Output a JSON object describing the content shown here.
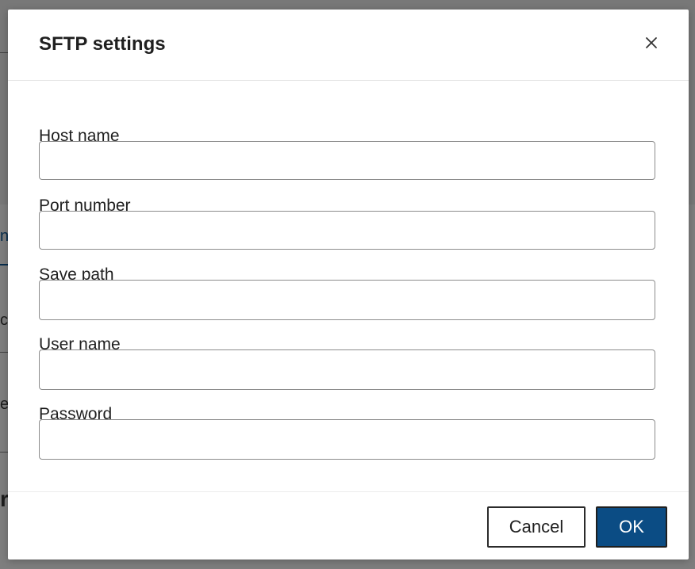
{
  "dialog": {
    "title": "SFTP settings",
    "close_icon": "close-icon",
    "fields": [
      {
        "label": "Host name",
        "value": "",
        "placeholder": ""
      },
      {
        "label": "Port number",
        "value": "",
        "placeholder": ""
      },
      {
        "label": "Save path",
        "value": "",
        "placeholder": ""
      },
      {
        "label": "User name",
        "value": "",
        "placeholder": ""
      },
      {
        "label": "Password",
        "value": "",
        "placeholder": ""
      }
    ],
    "buttons": {
      "cancel_label": "Cancel",
      "ok_label": "OK"
    }
  },
  "background": {
    "fragments": [
      "n",
      "c",
      "e",
      "r"
    ]
  },
  "colors": {
    "primary": "#0b4c84",
    "overlay": "#8a8a8a",
    "text": "#1f1f1f"
  }
}
